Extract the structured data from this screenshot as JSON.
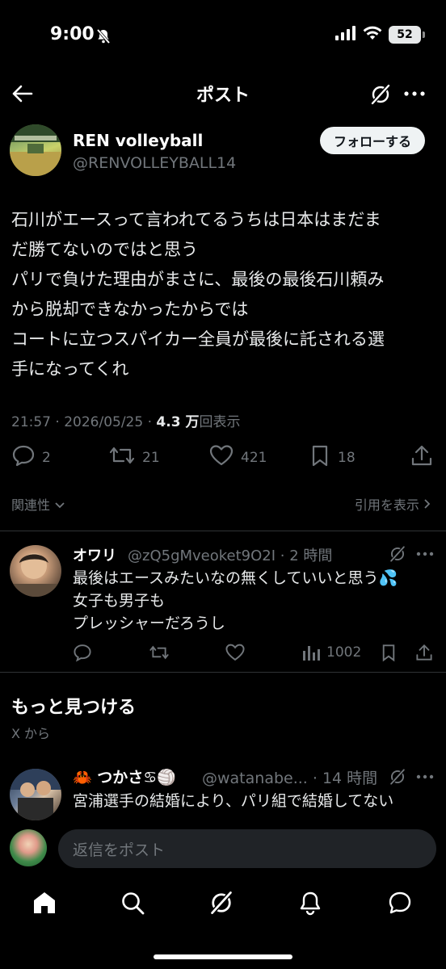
{
  "status_bar": {
    "time": "9:00",
    "battery": "52"
  },
  "header": {
    "title": "ポスト"
  },
  "post": {
    "author_name": "REN volleyball",
    "author_handle": "@RENVOLLEYBALL14",
    "follow_label": "フォローする",
    "text_lines": [
      "石川がエースって言われてるうちは日本はまだま",
      "だ勝てないのではと思う",
      "パリで負けた理由がまさに、最後の最後石川頼み",
      "から脱却できなかったからでは",
      "コートに立つスパイカー全員が最後に託される選",
      "手になってくれ"
    ],
    "timestamp": "21:57 · 2026/05/25 · ",
    "views_count": "4.3 万",
    "views_label": "回表示",
    "replies": "2",
    "reposts": "21",
    "likes": "421",
    "bookmarks": "18",
    "relevance_label": "関連性",
    "quotes_label": "引用を表示"
  },
  "reply": {
    "name": "オワリ",
    "handle_time": "@zQ5gMveoket9O2I · 2 時間",
    "text_lines": [
      "最後はエースみたいなの無くしていいと思う💦",
      "女子も男子も",
      "プレッシャーだろうし"
    ],
    "views": "1002"
  },
  "discover": {
    "title": "もっと見つける",
    "subtitle": "X から"
  },
  "recommended": {
    "name": "🦀 つかさ♋🏐",
    "handle_time": "@watanabe... · 14 時間",
    "text": "宮浦選手の結婚により、パリ組で結婚してない"
  },
  "composer": {
    "placeholder": "返信をポスト"
  },
  "colors": {
    "background": "#000000",
    "text": "#e7e9ea",
    "secondary": "#71767b",
    "divider": "#2f3336"
  }
}
